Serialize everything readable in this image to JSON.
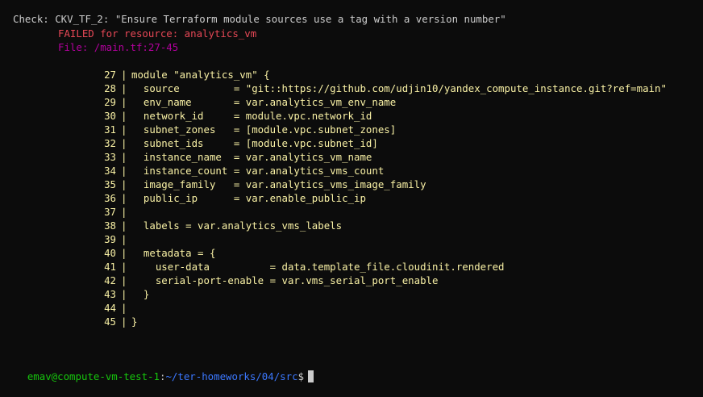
{
  "check": {
    "line": "Check: CKV_TF_2: \"Ensure Terraform module sources use a tag with a version number\"",
    "failed": "FAILED for resource: analytics_vm",
    "file": "File: /main.tf:27-45"
  },
  "code_lines": [
    {
      "num": "27",
      "text": "module \"analytics_vm\" {"
    },
    {
      "num": "28",
      "text": "  source         = \"git::https://github.com/udjin10/yandex_compute_instance.git?ref=main\""
    },
    {
      "num": "29",
      "text": "  env_name       = var.analytics_vm_env_name"
    },
    {
      "num": "30",
      "text": "  network_id     = module.vpc.network_id"
    },
    {
      "num": "31",
      "text": "  subnet_zones   = [module.vpc.subnet_zones]"
    },
    {
      "num": "32",
      "text": "  subnet_ids     = [module.vpc.subnet_id]"
    },
    {
      "num": "33",
      "text": "  instance_name  = var.analytics_vm_name"
    },
    {
      "num": "34",
      "text": "  instance_count = var.analytics_vms_count"
    },
    {
      "num": "35",
      "text": "  image_family   = var.analytics_vms_image_family"
    },
    {
      "num": "36",
      "text": "  public_ip      = var.enable_public_ip"
    },
    {
      "num": "37",
      "text": ""
    },
    {
      "num": "38",
      "text": "  labels = var.analytics_vms_labels"
    },
    {
      "num": "39",
      "text": ""
    },
    {
      "num": "40",
      "text": "  metadata = {"
    },
    {
      "num": "41",
      "text": "    user-data          = data.template_file.cloudinit.rendered"
    },
    {
      "num": "42",
      "text": "    serial-port-enable = var.vms_serial_port_enable"
    },
    {
      "num": "43",
      "text": "  }"
    },
    {
      "num": "44",
      "text": ""
    },
    {
      "num": "45",
      "text": "}"
    }
  ],
  "gutter_char": "|",
  "prompt": {
    "user_host": "emav@compute-vm-test-1",
    "separator": ":",
    "path": "~/ter-homeworks/04/src",
    "symbol": "$"
  },
  "colors": {
    "background": "#0c0c0c",
    "default_text": "#cccccc",
    "failed": "#e74856",
    "file": "#b4009e",
    "code": "#f9f1a5",
    "prompt_user": "#16c60c",
    "prompt_path": "#3b78ff"
  }
}
